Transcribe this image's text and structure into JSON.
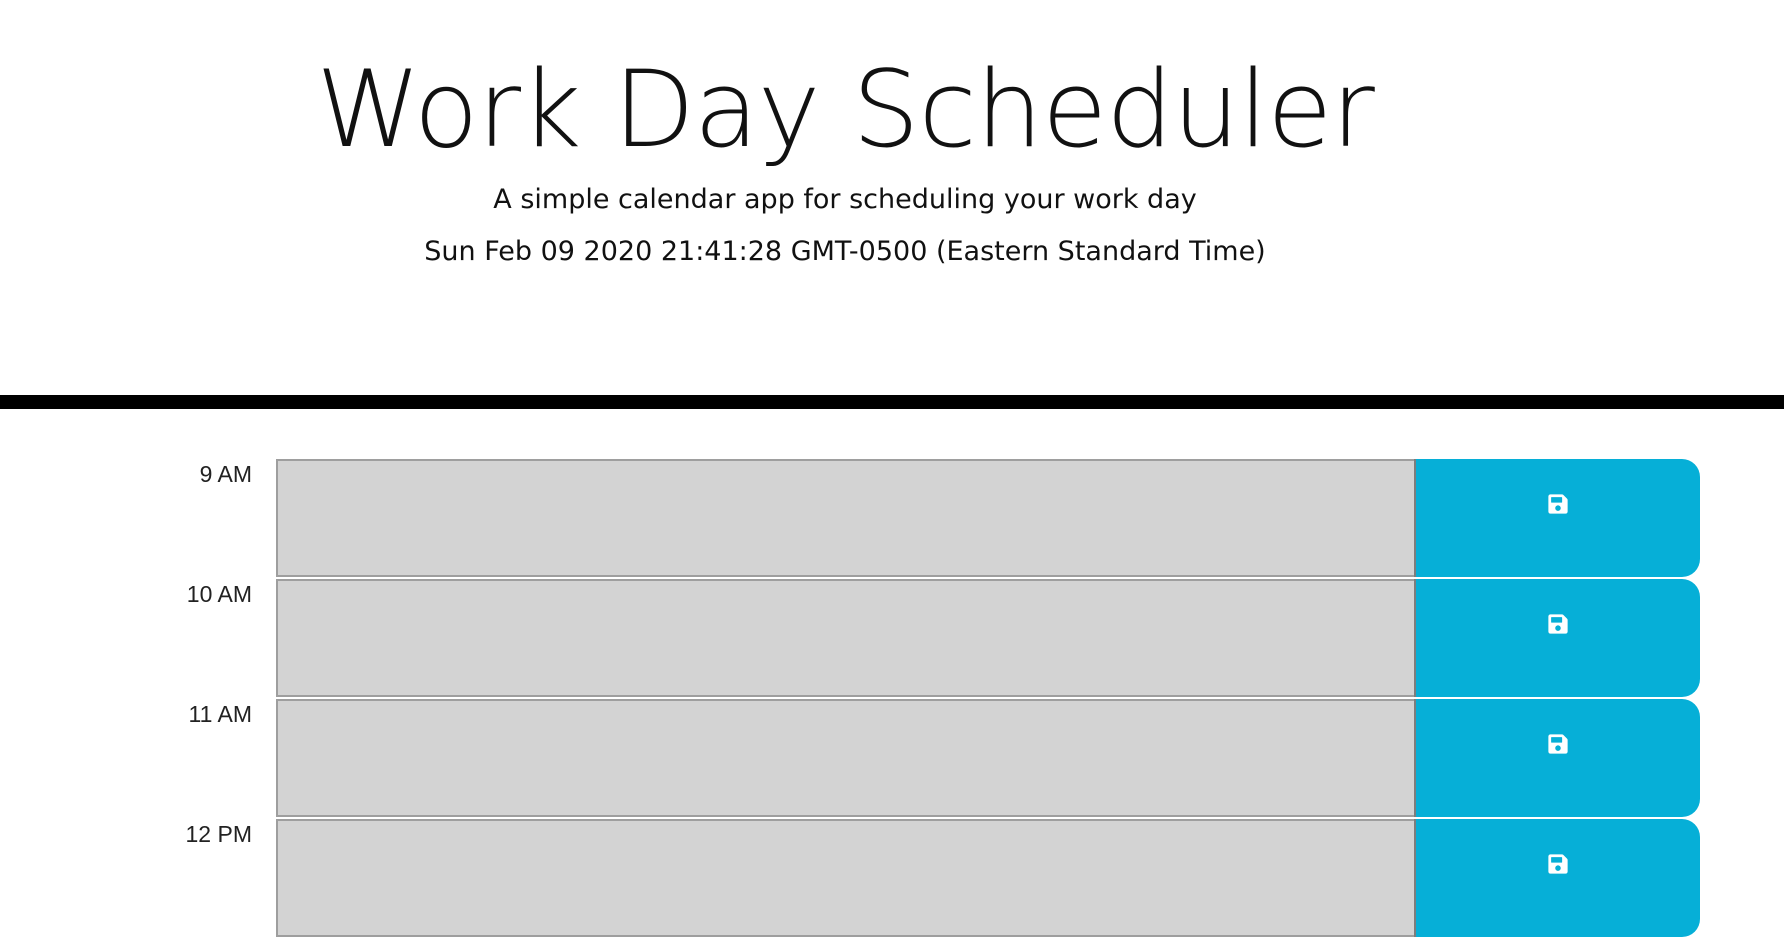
{
  "header": {
    "title": "Work Day Scheduler",
    "lead": "A simple calendar app for scheduling your work day",
    "current_day": "Sun Feb 09 2020 21:41:28 GMT-0500 (Eastern Standard Time)"
  },
  "time_blocks": [
    {
      "hour": "9 AM",
      "description": ""
    },
    {
      "hour": "10 AM",
      "description": ""
    },
    {
      "hour": "11 AM",
      "description": ""
    },
    {
      "hour": "12 PM",
      "description": ""
    }
  ],
  "colors": {
    "past_block": "#d3d3d3",
    "save_button": "#06afd7",
    "divider": "#000000"
  },
  "icons": {
    "save": "floppy-disk-icon"
  }
}
